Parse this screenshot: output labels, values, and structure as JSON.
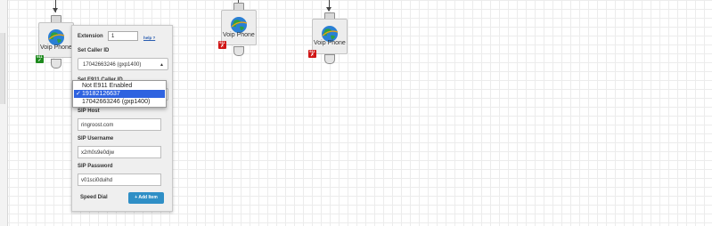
{
  "nodes": [
    {
      "label": "Voip Phone",
      "e911_enabled": true
    },
    {
      "label": "Voip Phone",
      "e911_enabled": false
    },
    {
      "label": "Voip Phone",
      "e911_enabled": false
    }
  ],
  "e911_badge": {
    "text": "911",
    "ok_icon": "✓",
    "bad_icon": "✗"
  },
  "panel": {
    "extension_label": "Extension",
    "extension_value": "1",
    "help_link": "help ?",
    "caller_id_label": "Set Caller ID",
    "caller_id_value": "17042663246 (gxp1400)",
    "e911_label": "Set E911 Caller ID",
    "sip_host_label": "SIP Host",
    "sip_host_value": "ringroost.com",
    "sip_username_label": "SIP Username",
    "sip_username_value": "x2rh0s9e0djw",
    "sip_password_label": "SIP Password",
    "sip_password_value": "v01sci0duihd",
    "speed_dial_label": "Speed Dial",
    "add_item_label": "Add Item"
  },
  "dropdown": {
    "options": [
      "Not E911 Enabled",
      "19182126637",
      "17042663246 (gxp1400)"
    ],
    "selected_index": 1,
    "check_mark": "✓"
  },
  "colors": {
    "accent": "#2f8fc6",
    "selected": "#2f63e0",
    "e911_ok": "#1e8a1e",
    "e911_bad": "#d01515"
  },
  "icons": [
    "globe-icon",
    "plus-icon",
    "check-icon",
    "select-arrows-icon"
  ]
}
